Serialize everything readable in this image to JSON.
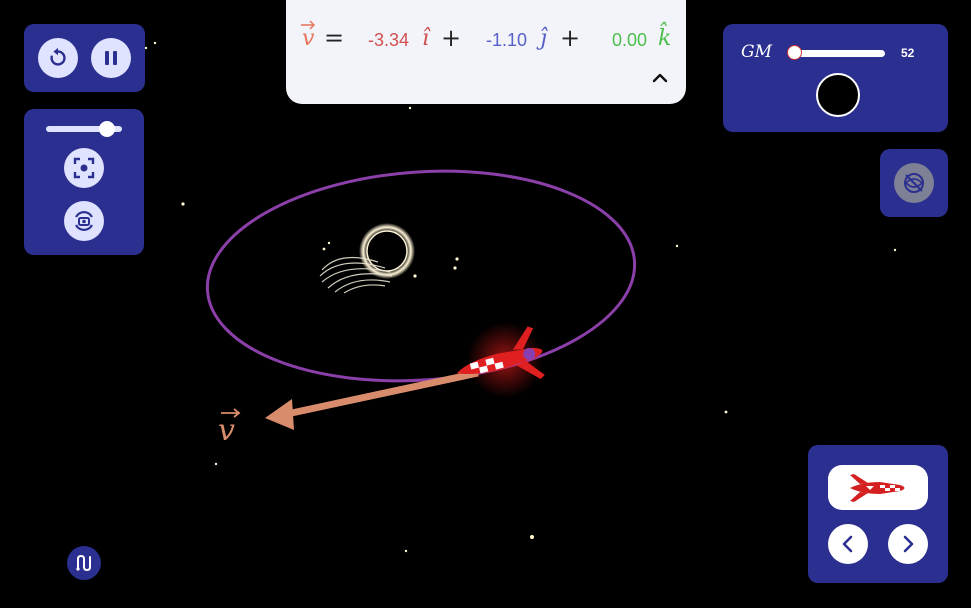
{
  "velocity": {
    "symbol": "v",
    "equals": "=",
    "plus": "+",
    "i_component": "-3.34",
    "j_component": "-1.10",
    "k_component": "0.00",
    "i_hat": "î",
    "j_hat": "ĵ",
    "k_hat": "k̂",
    "colors": {
      "v": "#e8735a",
      "i": "#d05050",
      "j": "#5560c8",
      "k": "#4cbf4c"
    }
  },
  "gravity": {
    "label": "GM",
    "value": "52",
    "slider_fraction": 0.05
  },
  "speed_slider": {
    "fraction": 0.8
  },
  "scene": {
    "vector_label": "v"
  },
  "colors": {
    "panel": "#2b2f8f",
    "orbit": "#8b3fa8",
    "vector": "#d98c6c",
    "rocket": "#d42020"
  },
  "icons": {
    "reset": "reset-icon",
    "pause": "pause-icon",
    "recenter": "recenter-icon",
    "camera_rotate": "camera-rotate-icon",
    "visibility": "visibility-off-icon",
    "collapse": "chevron-up-icon",
    "prev": "chevron-left-icon",
    "next": "chevron-right-icon",
    "trail": "trail-icon",
    "ship": "rocket-icon"
  }
}
